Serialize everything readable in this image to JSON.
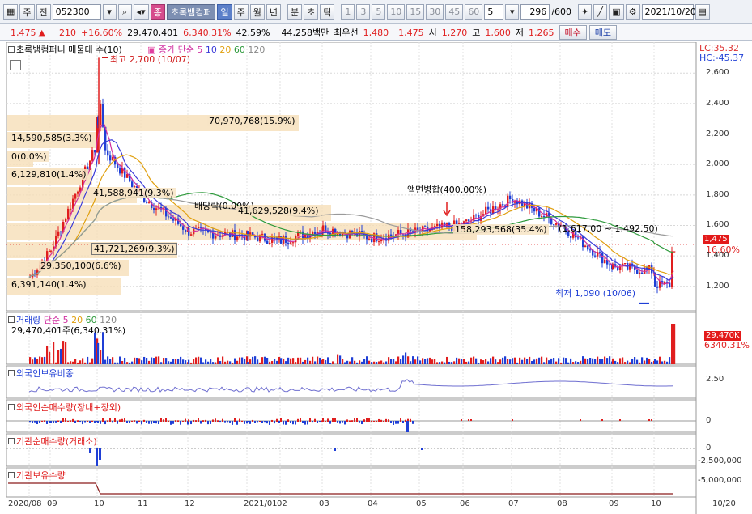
{
  "toolbar": {
    "market_label": "주",
    "prev_label": "전",
    "code": "052300",
    "sel_label": "종",
    "stock_name": "초록뱀컴퍼",
    "periods": [
      "일",
      "주",
      "월",
      "년"
    ],
    "intraday": [
      "분",
      "초",
      "틱"
    ],
    "intervals": [
      "1",
      "3",
      "5",
      "10",
      "15",
      "30",
      "45",
      "60"
    ],
    "count_value": "5",
    "range_value": "296",
    "range_max": "/600",
    "date_value": "2021/10/20"
  },
  "quote": {
    "price": "1,475",
    "up_arrow": "▲",
    "change": "210",
    "change_pct": "+16.60%",
    "volume": "29,470,401",
    "volume_ratio": "6,340.31%",
    "turnover": "42.59%",
    "amount": "44,258백만",
    "best_ask_label": "최우선",
    "best_ask": "1,480",
    "best_bid": "1,475",
    "open_label": "시",
    "open": "1,270",
    "high_label": "고",
    "high": "1,600",
    "low_label": "저",
    "low": "1,265",
    "buy_label": "매수",
    "sell_label": "매도"
  },
  "main_panel": {
    "title": "초록뱀컴퍼니 매물대 수(10)",
    "ma_label": "종가 단순",
    "ma_periods": [
      "5",
      "10",
      "20",
      "60",
      "120"
    ],
    "lc": "LC:35.32",
    "hc": "HC:-45.37",
    "price_tag": "1,475",
    "pct_tag": "16.60%",
    "high_note": "최고 2,700 (10/07)",
    "low_note": "최저 1,090 (10/06)",
    "event_note": "액면병합(400.00%)",
    "dividend_note": "배당락(0.00%)",
    "range_note": "(1,617.00 ~ 1,492.50)",
    "y_ticks": [
      "2,600",
      "2,400",
      "2,200",
      "2,000",
      "1,800",
      "1,600",
      "1,400",
      "1,200"
    ],
    "volume_profile": [
      "70,970,768(15.9%)",
      "14,590,585(3.3%)",
      "0(0.0%)",
      "6,129,810(1.4%)",
      "41,588,941(9.3%)",
      "41,629,528(9.4%)",
      "158,293,568(35.4%)",
      "41,721,269(9.3%)",
      "29,350,100(6.6%)",
      "6,391,140(1.4%)"
    ]
  },
  "volume_panel": {
    "title": "거래량",
    "ma_label": "단순",
    "ma_periods": [
      "5",
      "20",
      "60",
      "120"
    ],
    "value": "29,470,401주(6,340.31%)",
    "tag_value": "29,470K",
    "tag_pct": "6340.31%"
  },
  "foreign_hold_panel": {
    "title": "외국인보유비중",
    "y_ticks": [
      "2.50"
    ]
  },
  "foreign_net_panel": {
    "title": "외국인순매수량(장내+장외)",
    "y_ticks": [
      "0"
    ]
  },
  "inst_net_panel": {
    "title": "기관순매수량(거래소)",
    "y_ticks": [
      "0",
      "-2,500,000"
    ]
  },
  "inst_hold_panel": {
    "title": "기관보유수량",
    "y_ticks": [
      "-5,000,000"
    ]
  },
  "x_axis": [
    "2020/08",
    "09",
    "10",
    "11",
    "12",
    "2021/01",
    "02",
    "03",
    "04",
    "05",
    "06",
    "07",
    "08",
    "09",
    "10",
    "10/20"
  ],
  "colors": {
    "up": "#e01e1e",
    "down": "#1f3fd6",
    "ma5": "#d02fa0",
    "ma10": "#3a3ad8",
    "ma20": "#e0a010",
    "ma60": "#2e9a3c",
    "ma120": "#9a9a9a",
    "profile": "#f6dfb8"
  },
  "chart_data": {
    "type": "line",
    "title": "초록뱀컴퍼니 매물대 수(10)",
    "x": [
      "2020/08",
      "09",
      "10",
      "11",
      "12",
      "2021/01",
      "02",
      "03",
      "04",
      "05",
      "06",
      "07",
      "08",
      "09",
      "10"
    ],
    "series": [
      {
        "name": "종가",
        "values": [
          1260,
          1440,
          2150,
          1790,
          1560,
          1530,
          1500,
          1580,
          1520,
          1560,
          1610,
          1780,
          1600,
          1330,
          1300
        ]
      }
    ],
    "ylim": [
      1050,
      2750
    ],
    "annotations": [
      {
        "text": "최고 2,700 (10/07)",
        "x": "10",
        "y": 2700
      },
      {
        "text": "최저 1,090 (10/06)",
        "x": "10",
        "y": 1090
      },
      {
        "text": "액면병합(400.00%)",
        "x": "06",
        "y": 1600
      }
    ]
  }
}
